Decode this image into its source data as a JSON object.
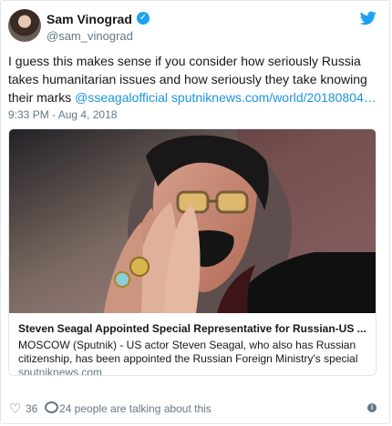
{
  "tweet": {
    "name": "Sam Vinograd",
    "handle": "@sam_vinograd",
    "text_prefix": "I guess this makes sense if you consider how seriously Russia takes humanitarian issues and how seriously they take knowing their marks ",
    "mention": "@sseagalofficial",
    "url": "sputniknews.com/world/20180804…",
    "timestamp": "9:33 PM - Aug 4, 2018"
  },
  "card": {
    "headline": "Steven Seagal Appointed Special Representative for Russian-US ...",
    "description": "MOSCOW (Sputnik) - US actor Steven Seagal, who also has Russian citizenship, has been appointed the Russian Foreign Ministry's special",
    "domain": "sputniknews.com"
  },
  "stats": {
    "likes": "36",
    "talking": "24 people are talking about this"
  },
  "icons": {
    "verified": "verified-icon",
    "bird": "twitter-bird-icon",
    "heart": "heart-icon",
    "comment": "comment-icon",
    "info": "info-icon"
  },
  "colors": {
    "accent": "#1da1f2",
    "link": "#1b95e0",
    "muted": "#657786"
  }
}
